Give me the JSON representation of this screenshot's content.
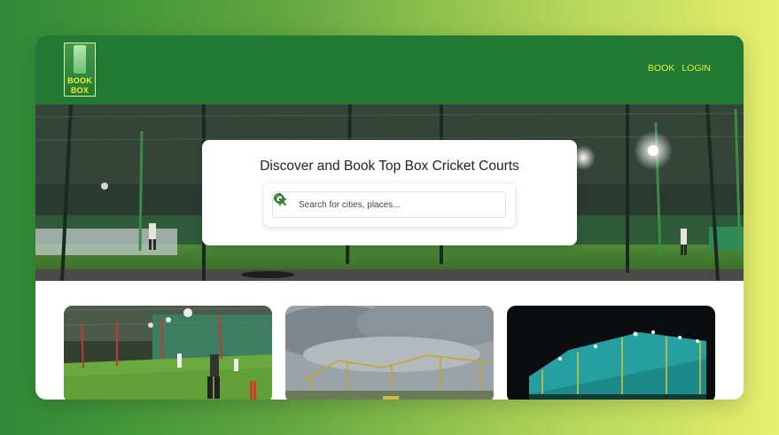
{
  "brand": {
    "logo_line1": "BOOK",
    "logo_line2": "BOX"
  },
  "nav": {
    "items": [
      {
        "label": "BOOK"
      },
      {
        "label": "LOGIN"
      }
    ]
  },
  "hero": {
    "headline": "Discover and Book Top Box Cricket Courts",
    "search": {
      "placeholder": "Search for cities, places...",
      "value": ""
    }
  },
  "icons": {
    "search": "search-icon",
    "locate": "crosshair-locate-icon"
  },
  "colors": {
    "nav_bg": "#217a34",
    "nav_link": "#e8ec3a",
    "logo_text": "#f4ec2a",
    "accent_green": "#2e7d32"
  }
}
